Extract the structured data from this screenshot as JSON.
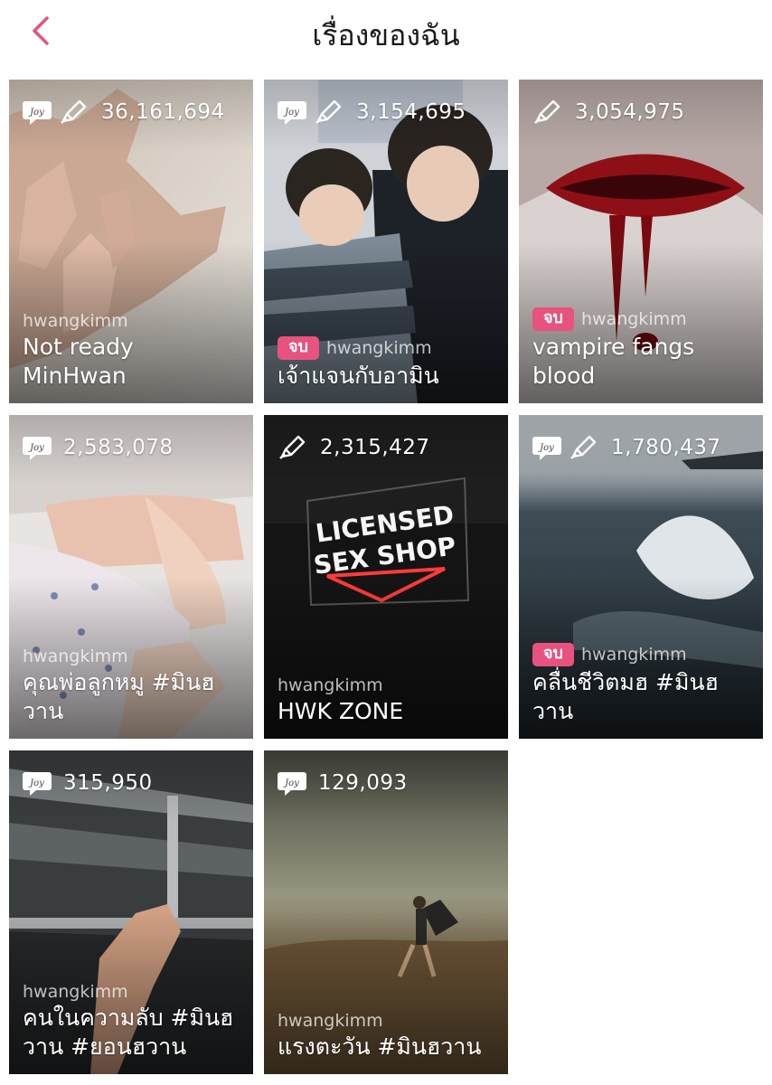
{
  "header": {
    "title": "เรื่องของฉัน",
    "back_icon": "chevron-left-icon",
    "accent": "#e8527f"
  },
  "stories": [
    {
      "count": "36,161,694",
      "icons": [
        "joy-icon",
        "pen-icon"
      ],
      "finished": false,
      "badge": "",
      "author": "hwangkimm",
      "title": "Not ready MinHwan"
    },
    {
      "count": "3,154,695",
      "icons": [
        "joy-icon",
        "pen-icon"
      ],
      "finished": true,
      "badge": "จบ",
      "author": "hwangkimm",
      "title": "เจ้าแจนกับอามิน"
    },
    {
      "count": "3,054,975",
      "icons": [
        "pen-icon"
      ],
      "finished": true,
      "badge": "จบ",
      "author": "hwangkimm",
      "title": "vampire fangs blood"
    },
    {
      "count": "2,583,078",
      "icons": [
        "joy-icon"
      ],
      "finished": false,
      "badge": "",
      "author": "hwangkimm",
      "title": "คุณพ่อลูกหมู #มินฮวาน"
    },
    {
      "count": "2,315,427",
      "icons": [
        "pen-icon"
      ],
      "finished": false,
      "badge": "",
      "author": "hwangkimm",
      "title": "HWK ZONE"
    },
    {
      "count": "1,780,437",
      "icons": [
        "joy-icon",
        "pen-icon"
      ],
      "finished": true,
      "badge": "จบ",
      "author": "hwangkimm",
      "title": "คลื่นชีวิตมฮ #มินฮวาน"
    },
    {
      "count": "315,950",
      "icons": [
        "joy-icon"
      ],
      "finished": false,
      "badge": "",
      "author": "hwangkimm",
      "title": "คนในความลับ #มินฮวาน #ยอนฮวาน"
    },
    {
      "count": "129,093",
      "icons": [
        "joy-icon"
      ],
      "finished": false,
      "badge": "",
      "author": "hwangkimm",
      "title": "แรงตะวัน #มินฮวาน"
    }
  ]
}
